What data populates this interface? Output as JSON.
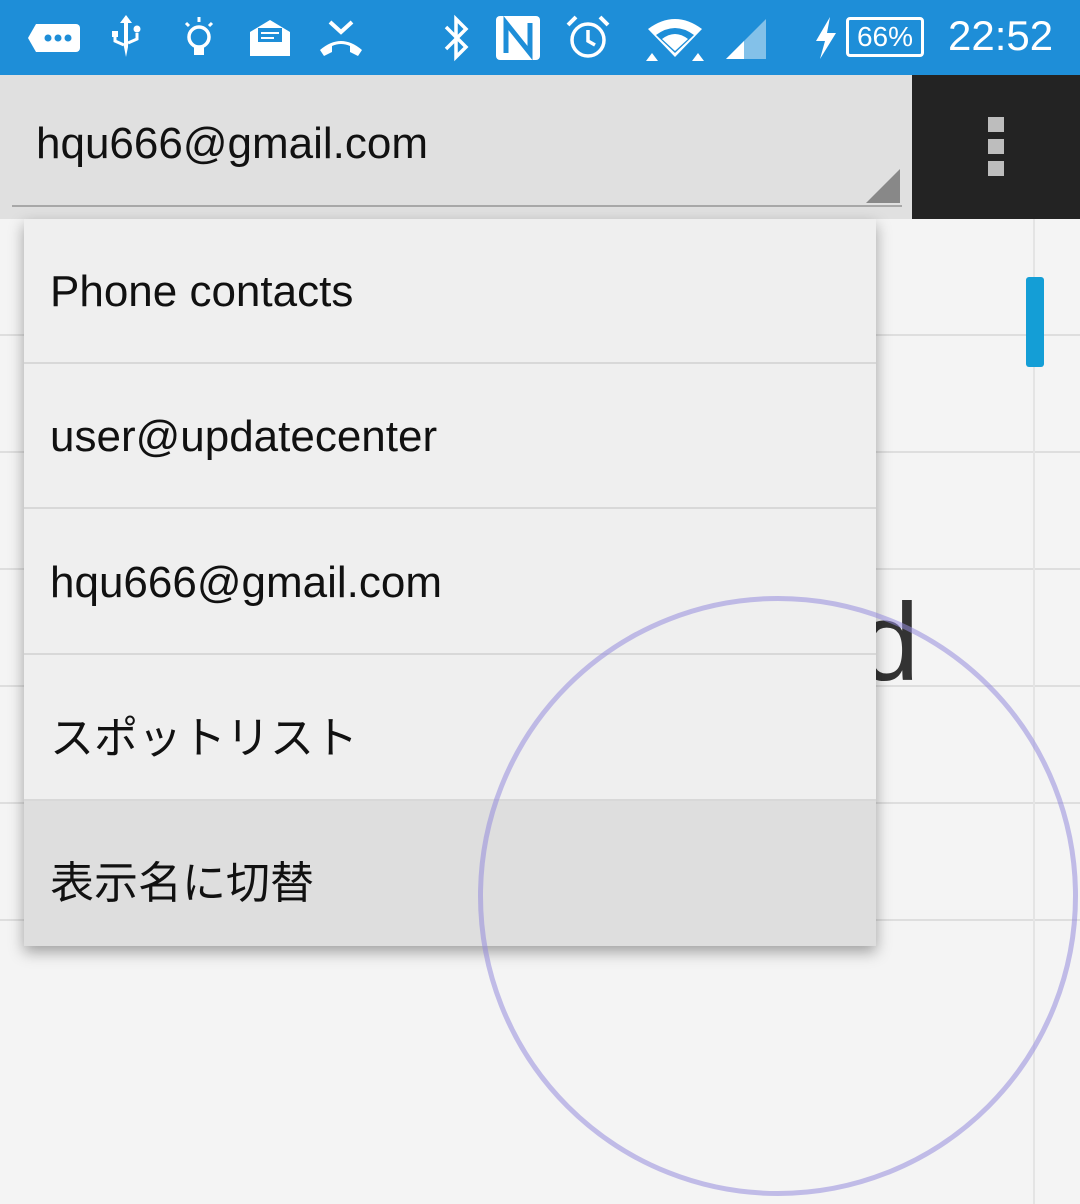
{
  "status_bar": {
    "icons": [
      "more-dots-icon",
      "usb-icon",
      "lightbulb-icon",
      "mail-icon",
      "missed-call-icon",
      "bluetooth-icon",
      "nfc-icon",
      "alarm-icon",
      "wifi-icon",
      "signal-icon",
      "charging-icon"
    ],
    "battery": "66%",
    "time": "22:52"
  },
  "toolbar": {
    "selected_account": "hqu666@gmail.com",
    "overflow_icon": "more-vert-icon"
  },
  "dropdown": {
    "items": [
      {
        "label": "Phone contacts"
      },
      {
        "label": "user@updatecenter"
      },
      {
        "label": "hqu666@gmail.com"
      },
      {
        "label": "スポットリスト"
      },
      {
        "label": "表示名に切替"
      }
    ]
  },
  "background": {
    "partial_letter": "d"
  },
  "colors": {
    "status_bar": "#1e8ed8",
    "toolbar": "#e0e0e0",
    "overflow_area": "#232323",
    "scroll_thumb": "#149ed6",
    "touch_ring": "#968cdc"
  }
}
